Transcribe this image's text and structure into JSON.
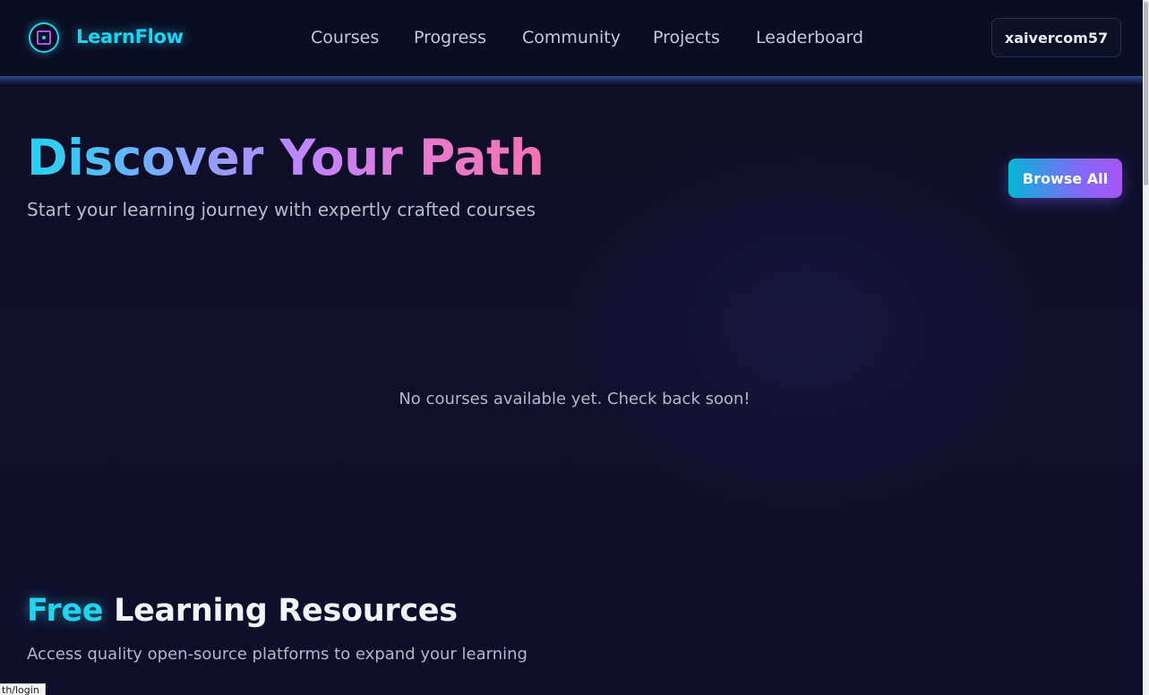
{
  "header": {
    "brand": "LearnFlow",
    "nav": [
      "Courses",
      "Progress",
      "Community",
      "Projects",
      "Leaderboard"
    ],
    "user": "xaivercom57"
  },
  "hero": {
    "title": "Discover Your Path",
    "subtitle": "Start your learning journey with expertly crafted courses",
    "browse_label": "Browse All"
  },
  "courses": {
    "empty_message": "No courses available yet. Check back soon!"
  },
  "resources": {
    "title_accent": "Free",
    "title_rest": " Learning Resources",
    "subtitle": "Access quality open-source platforms to expand your learning"
  },
  "status_bar": {
    "url": "th/login"
  },
  "colors": {
    "accent_cyan": "#22d3ee",
    "accent_purple": "#a855f7",
    "accent_pink": "#f472b6",
    "background": "#0c0c24"
  }
}
